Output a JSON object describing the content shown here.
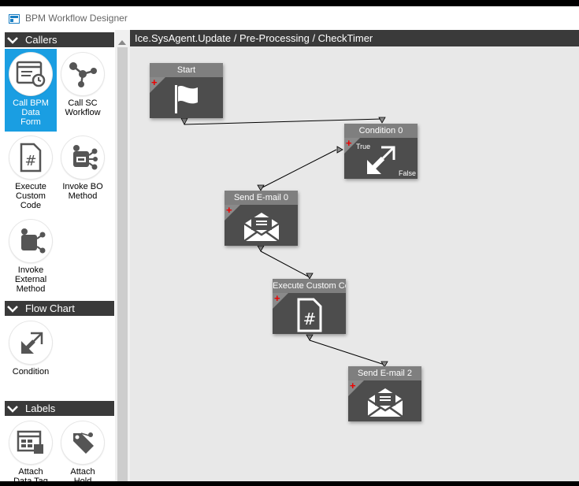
{
  "window": {
    "title": "BPM Workflow Designer"
  },
  "sidebar": {
    "sections": [
      {
        "title": "Callers"
      },
      {
        "title": "Flow Chart"
      },
      {
        "title": "Labels"
      }
    ],
    "tools": [
      {
        "label": "Call BPM\nData\nForm",
        "icon": "call-bpm-data-form-icon",
        "selected": true
      },
      {
        "label": "Call SC\nWorkflow",
        "icon": "call-sc-workflow-icon"
      },
      {
        "label": "Execute\nCustom\nCode",
        "icon": "execute-custom-code-icon"
      },
      {
        "label": "Invoke BO\nMethod",
        "icon": "invoke-bo-method-icon"
      },
      {
        "label": "Invoke\nExternal\nMethod",
        "icon": "invoke-external-method-icon"
      },
      {
        "label": "Condition",
        "icon": "condition-icon"
      },
      {
        "label": "Attach\nData Tag",
        "icon": "attach-data-tag-icon"
      },
      {
        "label": "Attach\nHold",
        "icon": "attach-hold-icon"
      }
    ]
  },
  "canvas": {
    "breadcrumb": "Ice.SysAgent.Update / Pre-Processing / CheckTimer",
    "nodes": [
      {
        "title": "Start",
        "icon": "flag-icon"
      },
      {
        "title": "Condition 0",
        "icon": "condition-icon",
        "true_label": "True",
        "false_label": "False"
      },
      {
        "title": "Send E-mail 0",
        "icon": "email-icon"
      },
      {
        "title": "Execute Custom Co",
        "icon": "custom-code-icon"
      },
      {
        "title": "Send E-mail 2",
        "icon": "email-icon"
      }
    ]
  },
  "colors": {
    "selected": "#1a9ee2",
    "header": "#3a3a3a",
    "node_body": "#4d4d4d",
    "node_header": "#7f7f7f",
    "canvas": "#e8e8e8",
    "add_marker": "#e00000"
  }
}
